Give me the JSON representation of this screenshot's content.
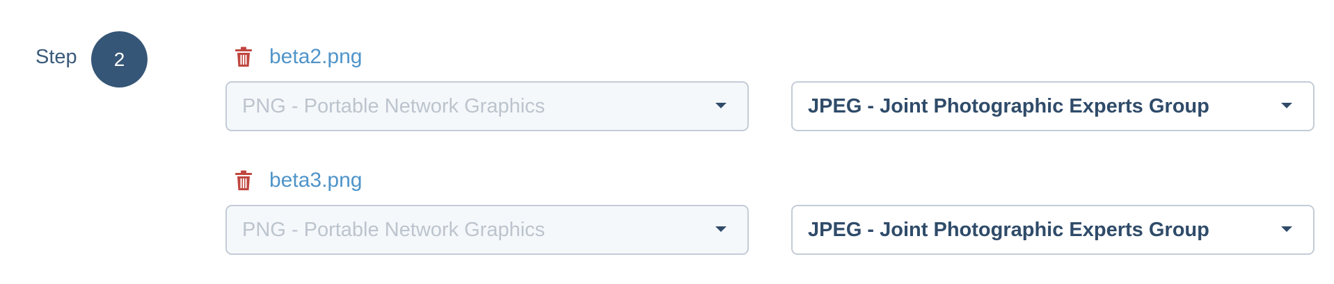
{
  "step": {
    "label": "Step",
    "number": "2"
  },
  "files": [
    {
      "name": "beta2.png",
      "delete_icon": "trash-icon",
      "from_format": "PNG - Portable Network Graphics",
      "to_format": "JPEG - Joint Photographic Experts Group"
    },
    {
      "name": "beta3.png",
      "delete_icon": "trash-icon",
      "from_format": "PNG - Portable Network Graphics",
      "to_format": "JPEG - Joint Photographic Experts Group"
    }
  ],
  "colors": {
    "step_circle": "#365677",
    "file_link": "#4f94c9",
    "trash": "#c0463f",
    "text_dark": "#2f4b69",
    "placeholder": "#bcc4cd"
  }
}
